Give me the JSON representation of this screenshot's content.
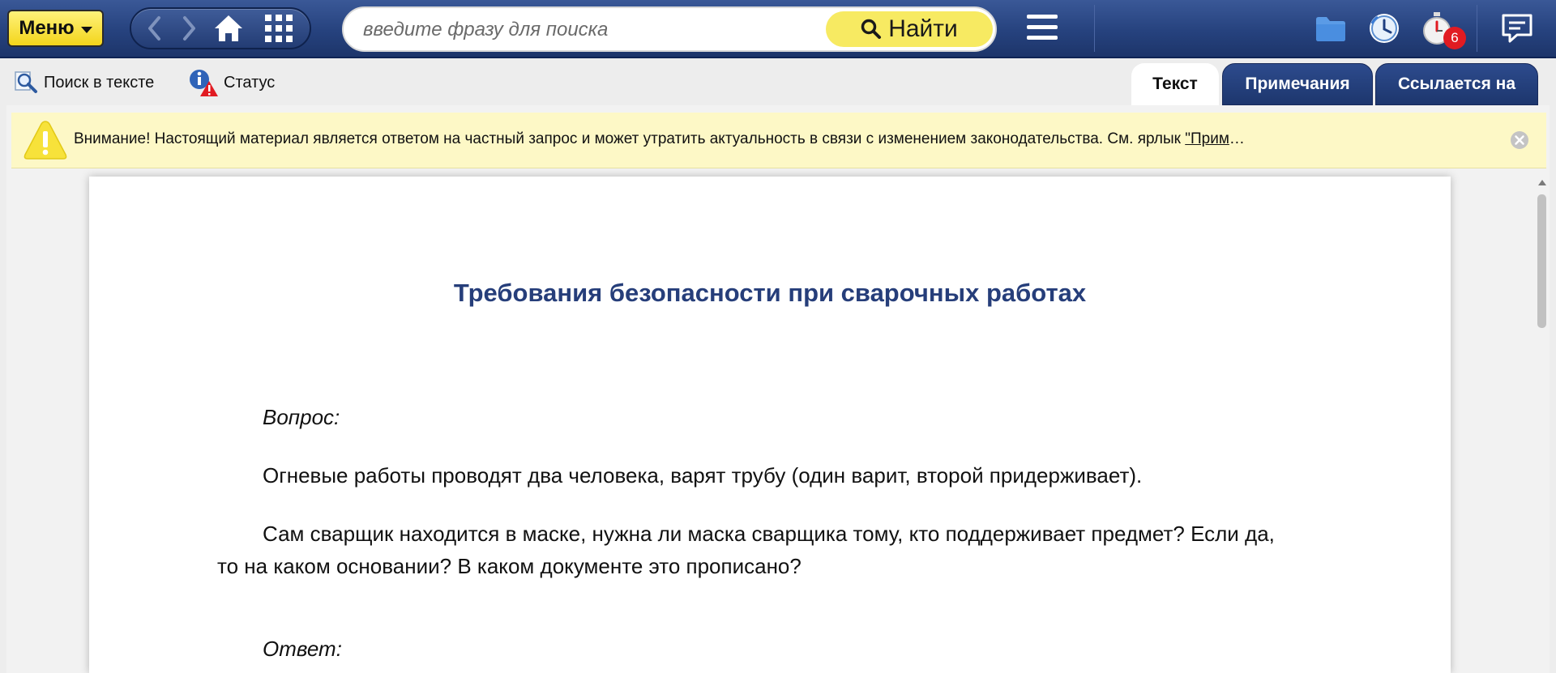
{
  "topbar": {
    "menu_label": "Меню",
    "search_placeholder": "введите фразу для поиска",
    "search_value": "",
    "find_label": "Найти",
    "timer_badge": "6"
  },
  "toolbar": {
    "search_in_text": "Поиск в тексте",
    "status": "Статус"
  },
  "tabs": [
    {
      "label": "Текст",
      "active": true
    },
    {
      "label": "Примечания",
      "active": false
    },
    {
      "label": "Ссылается на",
      "active": false
    }
  ],
  "warning": {
    "text": "Внимание! Настоящий материал является ответом на частный запрос и может утратить актуальность в связи с изменением законодательства. См. ярлык ",
    "link": "\"Прим",
    "ellipsis": "…"
  },
  "document": {
    "title": "Требования безопасности при сварочных работах",
    "question_label": "Вопрос:",
    "paragraph1": "Огневые работы проводят два человека, варят трубу (один варит, второй придерживает).",
    "paragraph2_line1": "Сам сварщик находится в маске, нужна ли маска сварщика тому, кто поддерживает предмет? Если да,",
    "paragraph2_line2": "то на каком основании? В каком документе это прописано?",
    "answer_label": "Ответ:"
  },
  "colors": {
    "topbar": "#26427e",
    "accent_yellow": "#f7ea62",
    "title_blue": "#263e7a",
    "warning_bg": "#fdf8c6",
    "badge_red": "#e11b22"
  },
  "icons": [
    "back-icon",
    "forward-icon",
    "home-icon",
    "apps-grid-icon",
    "search-icon",
    "hamburger-icon",
    "folder-icon",
    "history-clock-icon",
    "stopwatch-icon",
    "chat-icon",
    "magnifier-icon",
    "info-warning-icon",
    "warning-triangle-icon",
    "close-icon"
  ]
}
